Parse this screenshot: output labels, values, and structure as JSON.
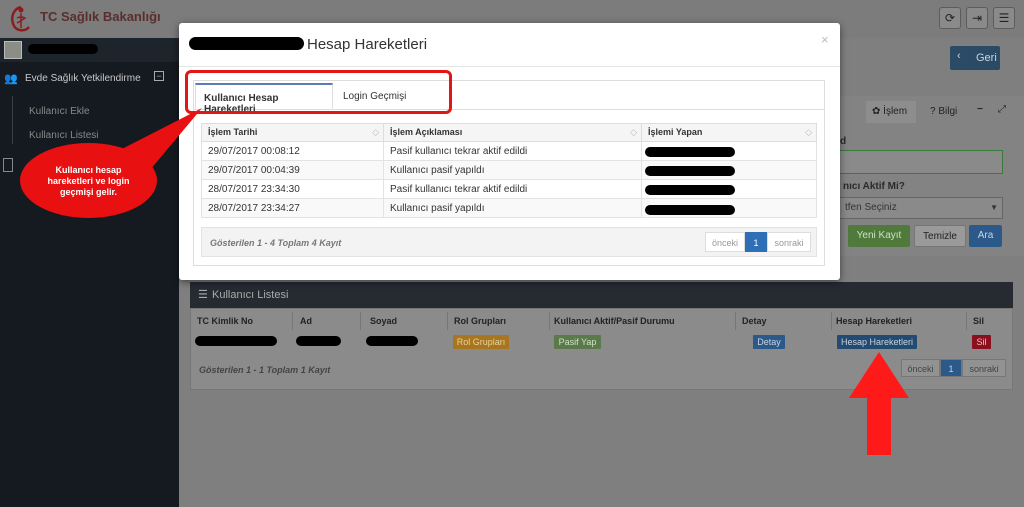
{
  "topbar": {
    "brand": "TC Sağlık Bakanlığı",
    "icons": [
      "refresh-icon",
      "logout-icon",
      "menu-icon"
    ],
    "icon_glyphs": [
      "⟳",
      "⇥",
      "☰"
    ]
  },
  "sidebar": {
    "menu_label": "Evde Sağlık Yetkilendirme",
    "toggle": "−",
    "items": [
      {
        "label": "Kullanıcı Ekle"
      },
      {
        "label": "Kullanıcı Listesi"
      }
    ]
  },
  "back_button": {
    "label": "Geri",
    "icon": "‹"
  },
  "right_panel": {
    "tab_islem": "İşlem",
    "tab_bilgi": "Bilgi",
    "tab_islem_icon": "✿",
    "tab_bilgi_icon": "?",
    "minus": "−",
    "expand": "⤢",
    "label_d": "d",
    "label_aktif": "nıcı Aktif Mi?",
    "select_value": "tfen Seçiniz",
    "btn_new": "Yeni Kayıt",
    "btn_clear": "Temizle",
    "btn_search": "Ara"
  },
  "list": {
    "title": "Kullanıcı Listesi",
    "columns": [
      "TC Kimlik No",
      "Ad",
      "Soyad",
      "Rol Grupları",
      "Kullanıcı Aktif/Pasif Durumu",
      "Detay",
      "Hesap Hareketleri",
      "Sil"
    ],
    "row": {
      "rol": "Rol Grupları",
      "durum": "Pasif Yap",
      "detay": "Detay",
      "hareket": "Hesap Hareketleri",
      "sil": "Sil"
    },
    "footer": "Gösterilen 1 - 1 Toplam 1 Kayıt",
    "pager": {
      "prev": "önceki",
      "page": "1",
      "next": "sonraki"
    }
  },
  "modal": {
    "title": "Hesap Hareketleri",
    "close": "×",
    "tabs": [
      {
        "label": "Kullanıcı Hesap Hareketleri"
      },
      {
        "label": "Login Geçmişi"
      }
    ],
    "columns": [
      "İşlem Tarihi",
      "İşlem Açıklaması",
      "İşlemi Yapan"
    ],
    "sort_glyph": "◇",
    "rows": [
      {
        "date": "29/07/2017 00:08:12",
        "desc": "Pasif kullanıcı tekrar aktif edildi"
      },
      {
        "date": "29/07/2017 00:04:39",
        "desc": "Kullanıcı pasif yapıldı"
      },
      {
        "date": "28/07/2017 23:34:30",
        "desc": "Pasif kullanıcı tekrar aktif edildi"
      },
      {
        "date": "28/07/2017 23:34:27",
        "desc": "Kullanıcı pasif yapıldı"
      }
    ],
    "footer": "Gösterilen 1 - 4 Toplam 4 Kayıt",
    "pager": {
      "prev": "önceki",
      "page": "1",
      "next": "sonraki"
    }
  },
  "callout": {
    "text": "Kullanıcı hesap hareketleri ve login geçmişi gelir."
  },
  "colors": {
    "highlight": "#e41515",
    "accent": "#2f6fb5",
    "sidebar": "#151a20"
  }
}
